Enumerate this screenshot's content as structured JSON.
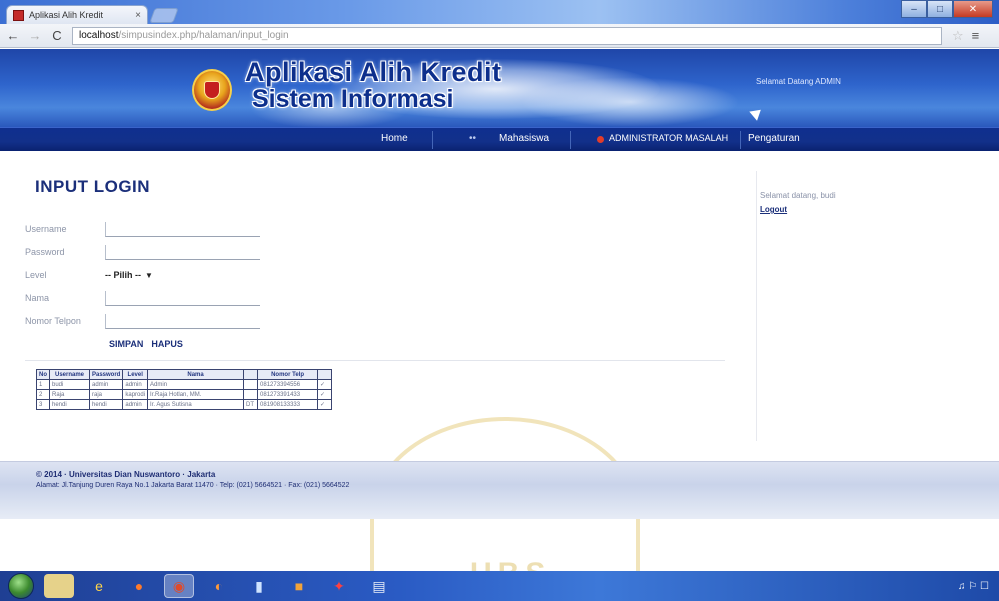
{
  "browser": {
    "tab_title": "Aplikasi Alih Kredit",
    "tab_close": "×",
    "url_host": "localhost",
    "url_path": "/simpusindex.php/halaman/input_login",
    "back_icon": "←",
    "forward_icon": "→",
    "reload_icon": "C",
    "star_icon": "☆",
    "wrench_icon": "≡",
    "window_controls": {
      "minimize": "–",
      "maximize": "□",
      "close": "✕"
    }
  },
  "header": {
    "title": "Aplikasi Alih Kredit",
    "subtitle": "Sistem Informasi",
    "user_info": "Selamat Datang ADMIN"
  },
  "menu": {
    "items": [
      {
        "label": "Home"
      },
      {
        "label": "Mahasiswa"
      },
      {
        "label": "ADMINISTRATOR MASALAH"
      },
      {
        "label": "Pengaturan"
      }
    ],
    "extra_marker": "••"
  },
  "form": {
    "title": "INPUT LOGIN",
    "fields": {
      "username_label": "Username",
      "password_label": "Password",
      "level_label": "Level",
      "level_value": "-- Pilih --",
      "level_arrow": "▼",
      "nama_label": "Nama",
      "telepon_label": "Nomor Telpon"
    },
    "buttons": {
      "save": "SIMPAN",
      "delete": "HAPUS"
    }
  },
  "table": {
    "headers": [
      "No",
      "Username",
      "Password",
      "Level",
      "Nama",
      "",
      "Nomor Telp",
      ""
    ],
    "rows": [
      [
        "1",
        "budi",
        "admin",
        "admin",
        "Admin",
        "",
        "081273394556",
        "✓"
      ],
      [
        "2",
        "Raja",
        "raja",
        "kaprodi",
        "Ir.Raja Hotlan, MM.",
        "",
        "081273391433",
        "✓"
      ],
      [
        "3",
        "hendi",
        "hendi",
        "admin",
        "Ir. Agus Sutisna",
        "DT",
        "081908133333",
        "✓"
      ]
    ]
  },
  "sidebar": {
    "text": "Selamat datang, budi",
    "link": "Logout"
  },
  "footer": {
    "line1": "© 2014 · Universitas Dian Nuswantoro · Jakarta",
    "line2": "Alamat: Jl.Tanjung Duren Raya No.1 Jakarta Barat 11470 · Telp: (021) 5664521 · Fax: (021) 5664522"
  },
  "watermark": {
    "text": "UBS"
  },
  "taskbar": {
    "icons": [
      "start-orb",
      "ie-icon",
      "folder-icon",
      "media-icon",
      "chrome-icon",
      "firefox-icon",
      "notepad-icon",
      "paint-icon",
      "red-app-icon",
      "document-icon"
    ],
    "tray_text": "♫ ⚐ ☐"
  },
  "colors": {
    "header_dark": "#1f46a8",
    "menu_bar": "#12308a",
    "title_blue": "#1b2f7a",
    "footer_bg": "#c9d3ea"
  }
}
